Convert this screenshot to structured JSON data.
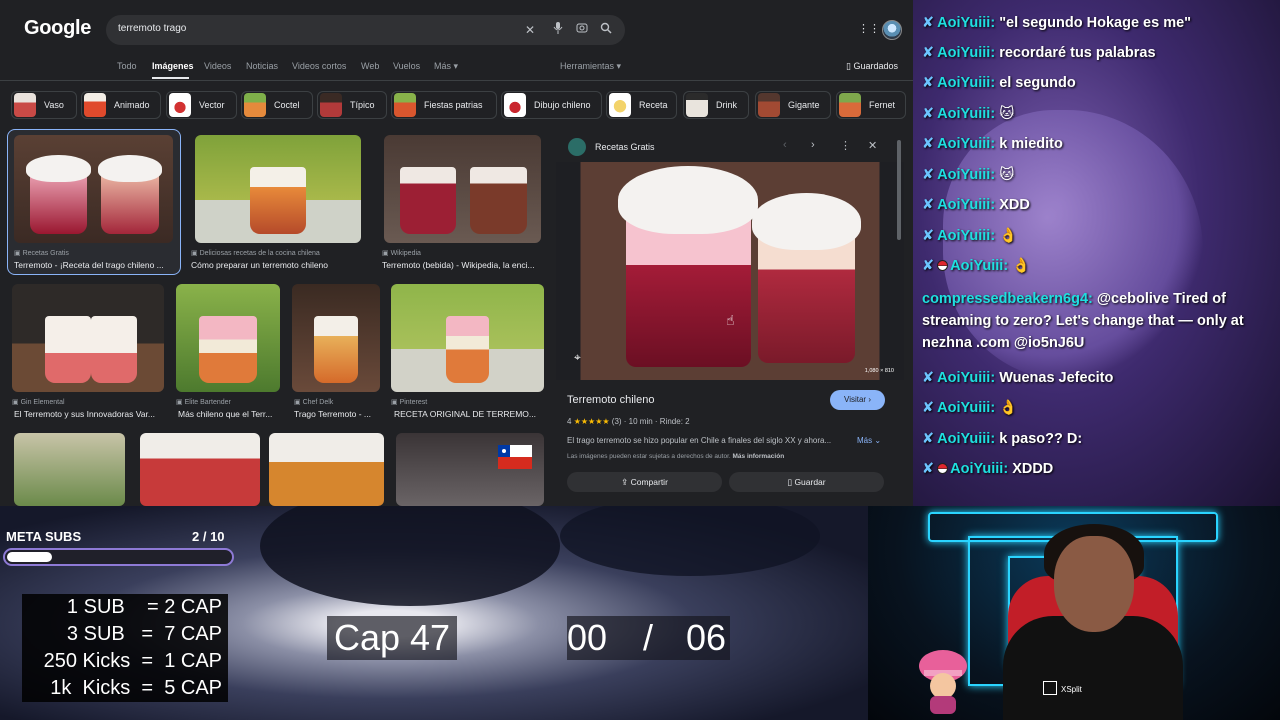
{
  "google": {
    "logo": "Google",
    "search": {
      "query": "terremoto trago"
    },
    "nav": [
      {
        "label": "Todo"
      },
      {
        "label": "Imágenes"
      },
      {
        "label": "Videos"
      },
      {
        "label": "Noticias"
      },
      {
        "label": "Videos cortos"
      },
      {
        "label": "Web"
      },
      {
        "label": "Vuelos"
      },
      {
        "label": "Más"
      }
    ],
    "tools_label": "Herramientas",
    "saved_label": "Guardados",
    "chips": [
      "Vaso",
      "Animado",
      "Vector",
      "Coctel",
      "Típico",
      "Fiestas patrias",
      "Dibujo chileno",
      "Receta",
      "Drink",
      "Gigante",
      "Fernet"
    ],
    "results": [
      {
        "source": "Recetas Gratis",
        "caption": "Terremoto - ¡Receta del trago chileno ..."
      },
      {
        "source": "Deliciosas recetas de la cocina chilena",
        "caption": "Cómo preparar un terremoto chileno"
      },
      {
        "source": "Wikipedia",
        "caption": "Terremoto (bebida) - Wikipedia, la enci..."
      },
      {
        "source": "Gin Elemental",
        "caption": "El Terremoto y sus Innovadoras Var..."
      },
      {
        "source": "Elite Bartender",
        "caption": "Más chileno que el Terr..."
      },
      {
        "source": "Chef Delk",
        "caption": "Trago Terremoto - ..."
      },
      {
        "source": "Pinterest",
        "caption": "RECETA ORIGINAL DE TERREMO..."
      }
    ],
    "preview": {
      "source": "Recetas Gratis",
      "dimensions": "1,080 × 810",
      "title": "Terremoto chileno",
      "visit_label": "Visitar",
      "rating_value": "4",
      "stars": "★★★★★",
      "rating_count": "(3)",
      "time": "10 min",
      "servings": "Rinde: 2",
      "description": "El trago terremoto se hizo popular en Chile a finales del siglo XX y ahora...",
      "more_label": "Más",
      "rights_text": "Las imágenes pueden estar sujetas a derechos de autor.",
      "rights_link": "Más información",
      "share_label": "Compartir",
      "save_label": "Guardar"
    }
  },
  "chat": {
    "messages": [
      {
        "badge": "sword",
        "user": "AoiYuiii:",
        "text": "\"el segundo Hokage es me\""
      },
      {
        "badge": "sword",
        "user": "AoiYuiii:",
        "text": "recordaré tus palabras"
      },
      {
        "badge": "sword",
        "user": "AoiYuiii:",
        "text": "el segundo"
      },
      {
        "badge": "sword",
        "user": "AoiYuiii:",
        "text": "🐱"
      },
      {
        "badge": "sword",
        "user": "AoiYuiii:",
        "text": "k miedito"
      },
      {
        "badge": "sword",
        "user": "AoiYuiii:",
        "text": "🐱"
      },
      {
        "badge": "sword",
        "user": "AoiYuiii:",
        "text": "XDD"
      },
      {
        "badge": "sword",
        "user": "AoiYuiii:",
        "text": "👌"
      },
      {
        "badge": "sword-ball",
        "user": "AoiYuiii:",
        "text": "👌"
      },
      {
        "badge": "none",
        "user": "compressedbeakern6g4:",
        "text": "@cebolive Tired of streaming to zero? Let's change that — only at nezhna .com @io5nJ6U"
      },
      {
        "badge": "sword",
        "user": "AoiYuiii:",
        "text": "Wuenas Jefecito"
      },
      {
        "badge": "sword",
        "user": "AoiYuiii:",
        "text": "👌"
      },
      {
        "badge": "sword",
        "user": "AoiYuiii:",
        "text": "k paso?? D:"
      },
      {
        "badge": "sword-ball",
        "user": "AoiYuiii:",
        "text": "XDDD"
      }
    ]
  },
  "stream": {
    "meta": {
      "title": "META SUBS",
      "current": 2,
      "goal": 10,
      "count_text": "2  / 10"
    },
    "rates": [
      "1 SUB    = 2 CAP",
      "3 SUB   =  7 CAP",
      "250 Kicks  =  1 CAP",
      "1k  Kicks  =  5 CAP"
    ],
    "cap_label": "Cap 47",
    "timer": {
      "left": "00",
      "sep": "/",
      "right": "06"
    },
    "xsplit_label": "XSplit"
  },
  "colors": {
    "google_bg": "#202124",
    "accent_blue": "#8ab4f8",
    "chat_user": "#1ee0e0",
    "meta_border": "#8e7ad6",
    "neon": "#2ad4ff"
  }
}
